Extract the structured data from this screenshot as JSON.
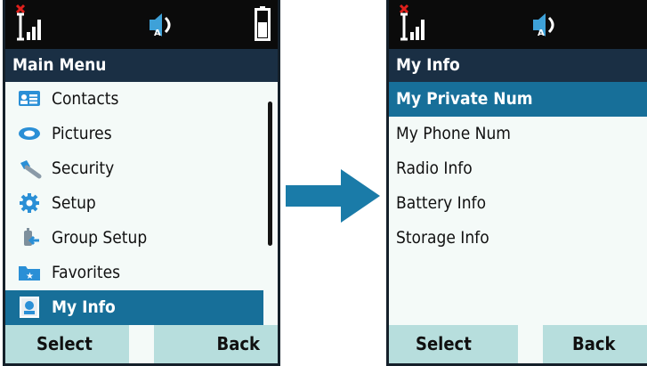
{
  "screens": [
    {
      "title": "Main Menu",
      "items": [
        {
          "label": "Contacts",
          "icon": "contacts-icon"
        },
        {
          "label": "Pictures",
          "icon": "pictures-icon"
        },
        {
          "label": "Security",
          "icon": "security-icon"
        },
        {
          "label": "Setup",
          "icon": "setup-gear-icon"
        },
        {
          "label": "Group Setup",
          "icon": "group-setup-icon"
        },
        {
          "label": "Favorites",
          "icon": "favorites-folder-icon"
        },
        {
          "label": "My Info",
          "icon": "my-info-icon",
          "selected": true
        }
      ],
      "softkeys": {
        "left": "Select",
        "right": "Back"
      }
    },
    {
      "title": "My Info",
      "items": [
        {
          "label": "My Private Num",
          "selected": true
        },
        {
          "label": "My Phone Num"
        },
        {
          "label": "Radio Info"
        },
        {
          "label": "Battery Info"
        },
        {
          "label": "Storage Info"
        }
      ],
      "softkeys": {
        "left": "Select",
        "right": "Back"
      }
    }
  ],
  "status_icons": [
    "antenna-signal-icon",
    "speaker-volume-icon",
    "battery-icon"
  ],
  "colors": {
    "selection": "#176f99",
    "titlebar": "#1a2f44",
    "softkeys": "#b7dedd",
    "menu_bg": "#f4faf8",
    "arrow": "#1a7ba8"
  }
}
